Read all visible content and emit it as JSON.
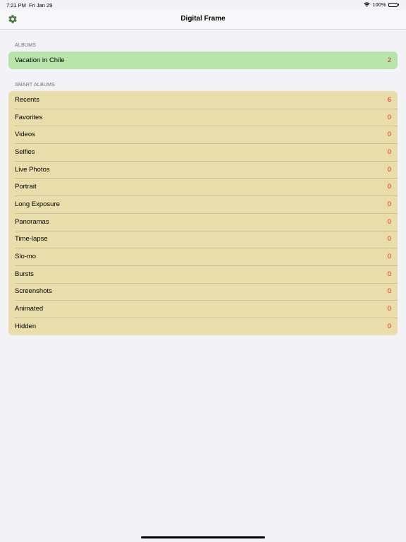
{
  "status_bar": {
    "time": "7:21 PM",
    "date": "Fri Jan 29",
    "battery_text": "100%"
  },
  "nav": {
    "title": "Digital Frame",
    "settings_icon": "gear-icon"
  },
  "albums": {
    "header": "ALBUMS",
    "items": [
      {
        "label": "Vacation in Chile",
        "count": "2"
      }
    ]
  },
  "smart_albums": {
    "header": "SMART ALBUMS",
    "items": [
      {
        "label": "Recents",
        "count": "6"
      },
      {
        "label": "Favorites",
        "count": "0"
      },
      {
        "label": "Videos",
        "count": "0"
      },
      {
        "label": "Selfies",
        "count": "0"
      },
      {
        "label": "Live Photos",
        "count": "0"
      },
      {
        "label": "Portrait",
        "count": "0"
      },
      {
        "label": "Long Exposure",
        "count": "0"
      },
      {
        "label": "Panoramas",
        "count": "0"
      },
      {
        "label": "Time-lapse",
        "count": "0"
      },
      {
        "label": "Slo-mo",
        "count": "0"
      },
      {
        "label": "Bursts",
        "count": "0"
      },
      {
        "label": "Screenshots",
        "count": "0"
      },
      {
        "label": "Animated",
        "count": "0"
      },
      {
        "label": "Hidden",
        "count": "0"
      }
    ]
  },
  "colors": {
    "background": "#f2f2f7",
    "albums_row": "#b6e4aa",
    "smart_albums_row": "#e8ddab",
    "count": "#e0241b",
    "accent_icon": "#4a7a3c"
  }
}
